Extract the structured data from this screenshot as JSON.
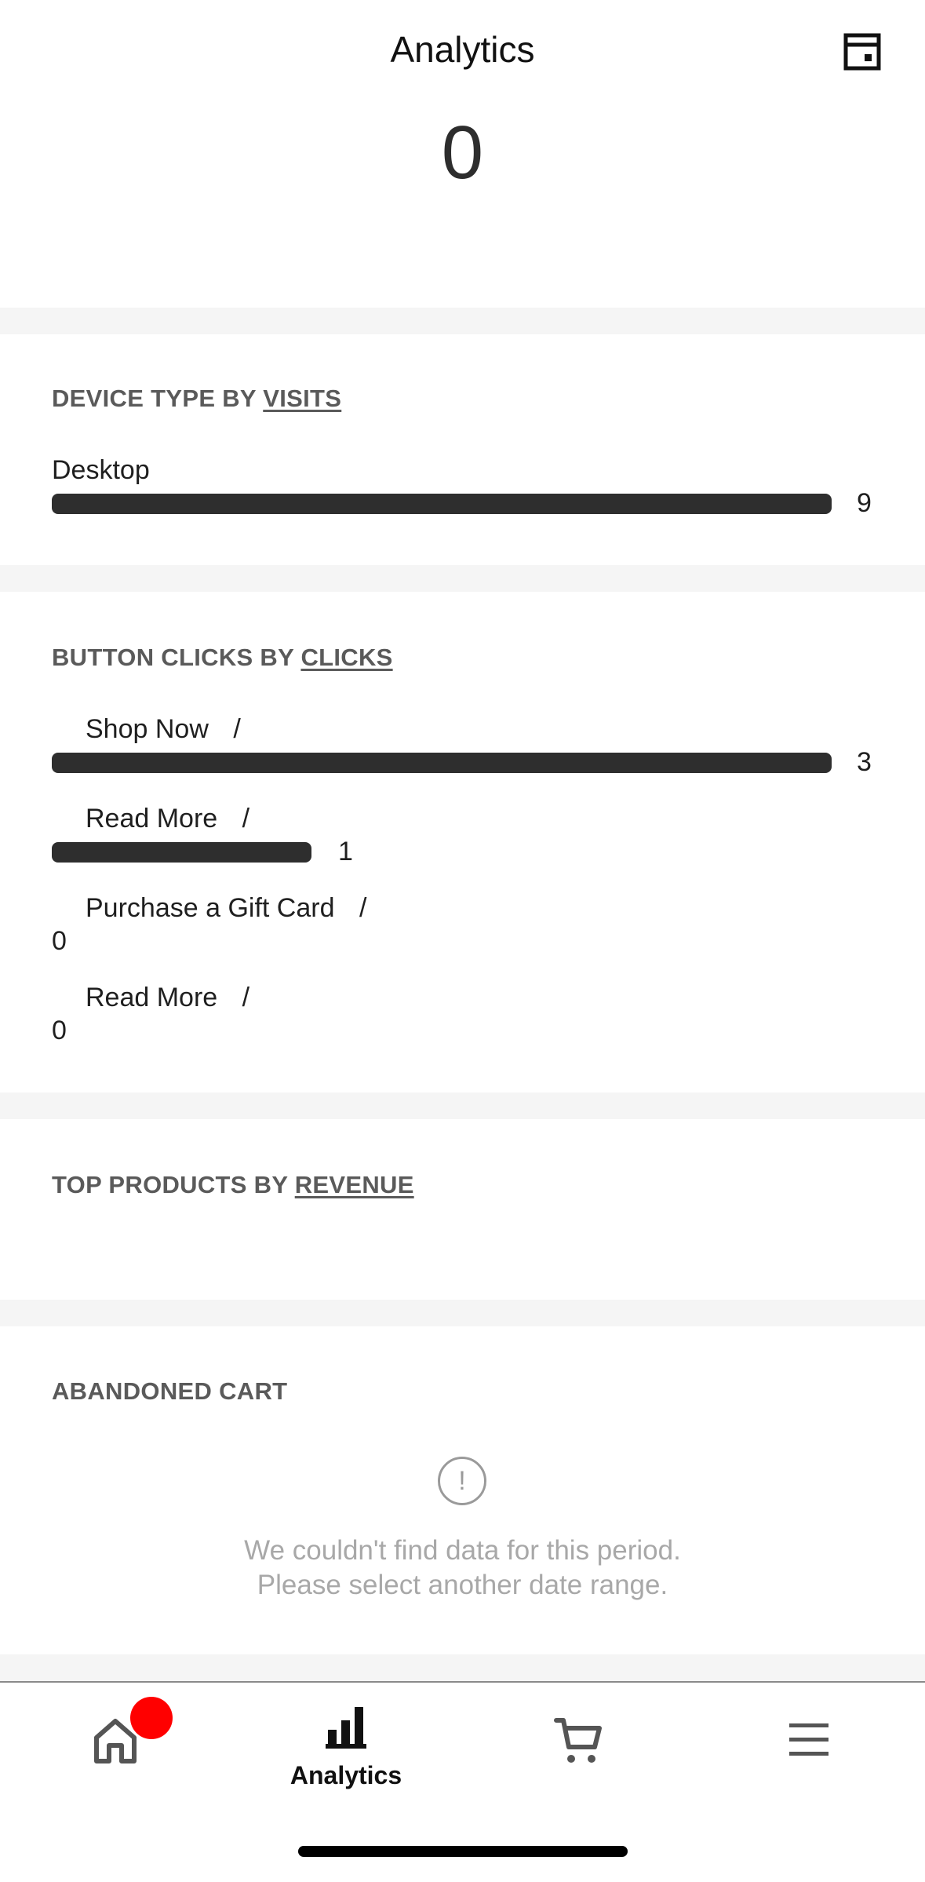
{
  "header": {
    "title": "Analytics",
    "calendar_icon": "calendar-icon"
  },
  "summary": {
    "value": "0"
  },
  "device_type": {
    "label_prefix": "DEVICE TYPE BY",
    "metric_link": "VISITS",
    "rows": [
      {
        "label": "Desktop",
        "value": "9",
        "fraction": 1.0
      }
    ]
  },
  "button_clicks": {
    "label_prefix": "BUTTON CLICKS BY",
    "metric_link": "CLICKS",
    "rows": [
      {
        "label": "Shop Now",
        "separator": "/",
        "value": "3",
        "fraction": 1.0
      },
      {
        "label": "Read More",
        "separator": "/",
        "value": "1",
        "fraction": 0.333
      },
      {
        "label": "Purchase a Gift Card",
        "separator": "/",
        "value": "0",
        "fraction": 0
      },
      {
        "label": "Read More",
        "separator": "/",
        "value": "0",
        "fraction": 0
      }
    ]
  },
  "top_products": {
    "label_prefix": "TOP PRODUCTS BY",
    "metric_link": "REVENUE"
  },
  "abandoned_cart": {
    "label": "ABANDONED CART",
    "empty_icon_glyph": "!",
    "empty_line1": "We couldn't find data for this period.",
    "empty_line2": "Please select another date range."
  },
  "tabbar": {
    "tabs": [
      {
        "icon": "home-icon",
        "label": "",
        "has_badge": true,
        "badge_color": "#ff0000"
      },
      {
        "icon": "bar-chart-icon",
        "label": "Analytics",
        "active": true
      },
      {
        "icon": "cart-icon",
        "label": ""
      },
      {
        "icon": "menu-icon",
        "label": ""
      }
    ]
  }
}
